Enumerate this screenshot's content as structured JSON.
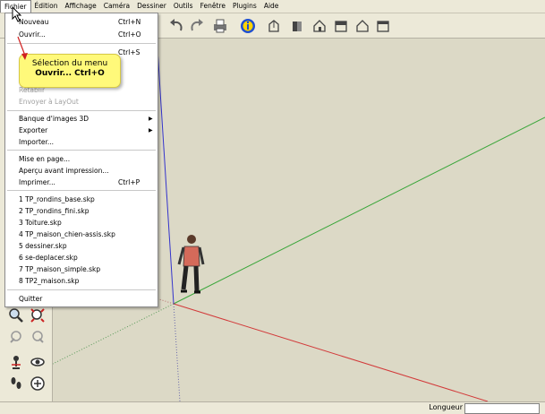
{
  "menubar": {
    "items": [
      "Fichier",
      "Édition",
      "Affichage",
      "Caméra",
      "Dessiner",
      "Outils",
      "Fenêtre",
      "Plugins",
      "Aide"
    ]
  },
  "file_menu": {
    "new_label": "Nouveau",
    "new_shortcut": "Ctrl+N",
    "open_label": "Ouvrir...",
    "open_shortcut": "Ctrl+O",
    "save_shortcut": "Ctrl+S",
    "revert_label": "Rétablir",
    "send_layout_label": "Envoyer à LayOut",
    "warehouse_label": "Banque d'images 3D",
    "export_label": "Exporter",
    "import_label": "Importer...",
    "page_setup_label": "Mise en page...",
    "print_preview_label": "Aperçu avant impression...",
    "print_label": "Imprimer...",
    "print_shortcut": "Ctrl+P",
    "recent_files": [
      "1 TP_rondins_base.skp",
      "2 TP_rondins_fini.skp",
      "3 Toiture.skp",
      "4 TP_maison_chien-assis.skp",
      "5 dessiner.skp",
      "6 se-deplacer.skp",
      "7 TP_maison_simple.skp",
      "8 TP2_maison.skp"
    ],
    "quit_label": "Quitter"
  },
  "callout": {
    "line1": "Sélection du menu",
    "line2": "Ouvrir... Ctrl+O"
  },
  "status": {
    "measure_label": "Longueur",
    "measure_value": ""
  },
  "colors": {
    "axis_red": "#d23a3a",
    "axis_green": "#3aa63a",
    "axis_blue": "#3333cc",
    "viewport_bg": "#dcd9c6",
    "callout_bg": "#fff97a"
  }
}
